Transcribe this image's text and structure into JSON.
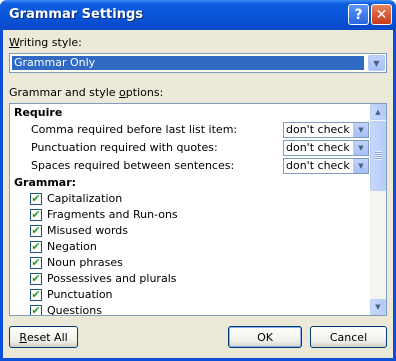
{
  "window": {
    "title": "Grammar Settings",
    "help_glyph": "?",
    "close_glyph": "✕"
  },
  "writing_style": {
    "label_key": "W",
    "label_rest": "riting style:",
    "value": "Grammar Only"
  },
  "options_label": {
    "before": "Grammar and style ",
    "key": "o",
    "after": "ptions:"
  },
  "require": {
    "header": "Require",
    "items": [
      {
        "label": "Comma required before last list item:",
        "value": "don't check"
      },
      {
        "label": "Punctuation required with quotes:",
        "value": "don't check"
      },
      {
        "label": "Spaces required between sentences:",
        "value": "don't check"
      }
    ]
  },
  "grammar": {
    "header": "Grammar:",
    "items": [
      {
        "label": "Capitalization",
        "checked": true
      },
      {
        "label": "Fragments and Run-ons",
        "checked": true
      },
      {
        "label": "Misused words",
        "checked": true
      },
      {
        "label": "Negation",
        "checked": true
      },
      {
        "label": "Noun phrases",
        "checked": true
      },
      {
        "label": "Possessives and plurals",
        "checked": true
      },
      {
        "label": "Punctuation",
        "checked": true
      },
      {
        "label": "Questions",
        "checked": true
      }
    ]
  },
  "buttons": {
    "reset_key": "R",
    "reset_rest": "eset All",
    "ok": "OK",
    "cancel": "Cancel"
  },
  "icons": {
    "check": "✔",
    "dropdown": "▼",
    "scroll_up": "▲",
    "scroll_down": "▼"
  },
  "colors": {
    "titlebar": "#0a54d8",
    "dialog_bg": "#ece9d8",
    "selection": "#316ac5",
    "check": "#21a121"
  }
}
